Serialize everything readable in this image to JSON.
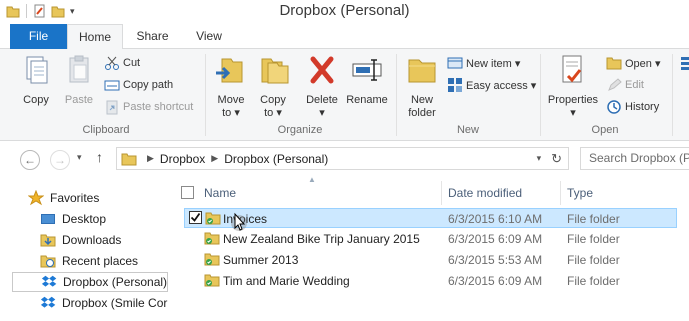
{
  "window": {
    "title": "Dropbox (Personal)"
  },
  "tabs": {
    "file": "File",
    "home": "Home",
    "share": "Share",
    "view": "View"
  },
  "ribbon": {
    "clipboard": {
      "label": "Clipboard",
      "copy": "Copy",
      "paste": "Paste",
      "cut": "Cut",
      "copy_path": "Copy path",
      "paste_shortcut": "Paste shortcut"
    },
    "organize": {
      "label": "Organize",
      "move_to": "Move\nto ▾",
      "move_line1": "Move",
      "move_line2": "to ▾",
      "copy_line1": "Copy",
      "copy_line2": "to ▾",
      "delete": "Delete",
      "delete_arrow": "▾",
      "rename": "Rename"
    },
    "new": {
      "label": "New",
      "new_folder_line1": "New",
      "new_folder_line2": "folder",
      "new_item": "New item ▾",
      "easy_access": "Easy access ▾"
    },
    "open": {
      "label": "Open",
      "properties": "Properties",
      "properties_arrow": "▾",
      "open": "Open ▾",
      "edit": "Edit",
      "history": "History"
    }
  },
  "address": {
    "crumbs": [
      "Dropbox",
      "Dropbox (Personal)"
    ],
    "search_placeholder": "Search Dropbox (Pe"
  },
  "nav": {
    "favorites": "Favorites",
    "items": [
      "Desktop",
      "Downloads",
      "Recent places",
      "Dropbox (Personal)",
      "Dropbox (Smile Corp"
    ]
  },
  "columns": {
    "name": "Name",
    "date": "Date modified",
    "type": "Type"
  },
  "files": [
    {
      "name": "Invoices",
      "date": "6/3/2015 6:10 AM",
      "type": "File folder"
    },
    {
      "name": "New Zealand Bike Trip January 2015",
      "date": "6/3/2015 6:09 AM",
      "type": "File folder"
    },
    {
      "name": "Summer 2013",
      "date": "6/3/2015 5:53 AM",
      "type": "File folder"
    },
    {
      "name": "Tim and Marie Wedding",
      "date": "6/3/2015 6:09 AM",
      "type": "File folder"
    }
  ]
}
